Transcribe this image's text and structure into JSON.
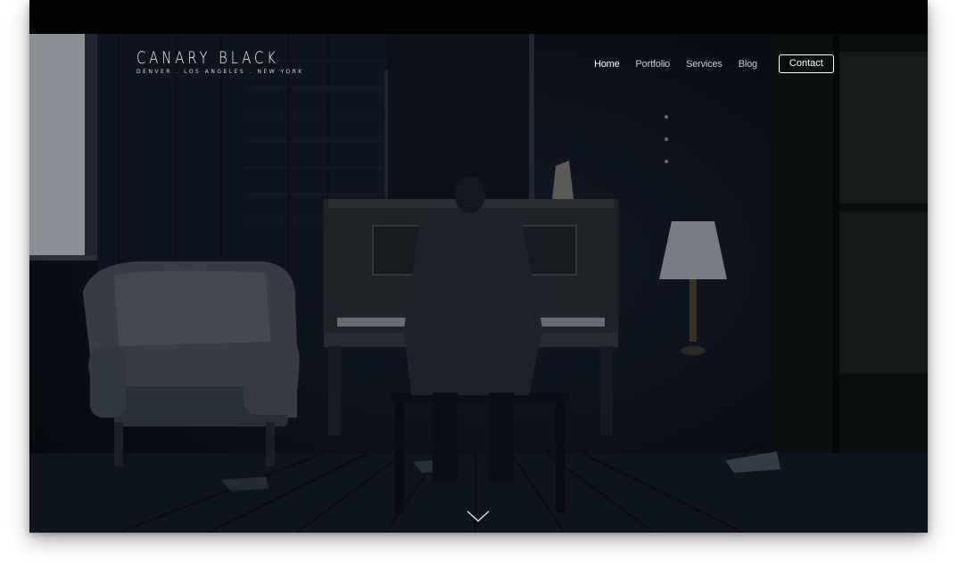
{
  "brand": {
    "name": "CANARY BLACK",
    "locations": "DENVER . LOS ANGELES . NEW YORK"
  },
  "nav": {
    "items": [
      {
        "label": "Home",
        "active": true
      },
      {
        "label": "Portfolio",
        "active": false
      },
      {
        "label": "Services",
        "active": false
      },
      {
        "label": "Blog",
        "active": false
      }
    ],
    "contact_label": "Contact"
  },
  "hero": {
    "scroll_icon": "chevron-down-icon"
  },
  "colors": {
    "topbar": "#010204",
    "scene_dark": "#0b1019",
    "text": "#ffffff"
  }
}
